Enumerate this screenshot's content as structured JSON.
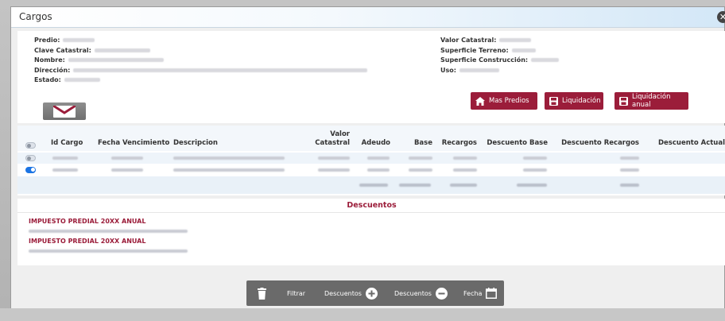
{
  "window": {
    "title": "Cargos"
  },
  "info_left": [
    {
      "label": "Predio:"
    },
    {
      "label": "Clave Catastral:"
    },
    {
      "label": "Nombre:"
    },
    {
      "label": "Dirección:"
    },
    {
      "label": "Estado:"
    }
  ],
  "info_right": [
    {
      "label": "Valor Catastral:"
    },
    {
      "label": "Superficie Terreno:"
    },
    {
      "label": "Superficie Construcción:"
    },
    {
      "label": "Uso:"
    }
  ],
  "actions": {
    "mas_predios": "Mas Predios",
    "liquidacion": "Liquidación",
    "liquidacion_anual": "Liquidación anual"
  },
  "table": {
    "headers": {
      "id_cargo": "Id Cargo",
      "fecha_vencimiento": "Fecha Vencimiento",
      "descripcion": "Descripcion",
      "valor_catastral_1": "Valor",
      "valor_catastral_2": "Catastral",
      "adeudo": "Adeudo",
      "base": "Base",
      "recargos": "Recargos",
      "descuento_base": "Descuento Base",
      "descuento_recargos": "Descuento Recargos",
      "descuento_actual": "Descuento Actual"
    },
    "rows": [
      {
        "selected": false
      },
      {
        "selected": true
      }
    ]
  },
  "descuentos": {
    "title": "Descuentos",
    "items": [
      {
        "name": "IMPUESTO PREDIAL 20XX ANUAL"
      },
      {
        "name": "IMPUESTO PREDIAL 20XX ANUAL"
      }
    ]
  },
  "toolbar": {
    "filtrar": "Filtrar",
    "descuentos_add": "Descuentos",
    "descuentos_remove": "Descuentos",
    "fecha": "Fecha"
  },
  "colors": {
    "accent": "#9b1d3a",
    "toggle_on": "#1b74e4",
    "toolbar": "#6a6a6a"
  }
}
